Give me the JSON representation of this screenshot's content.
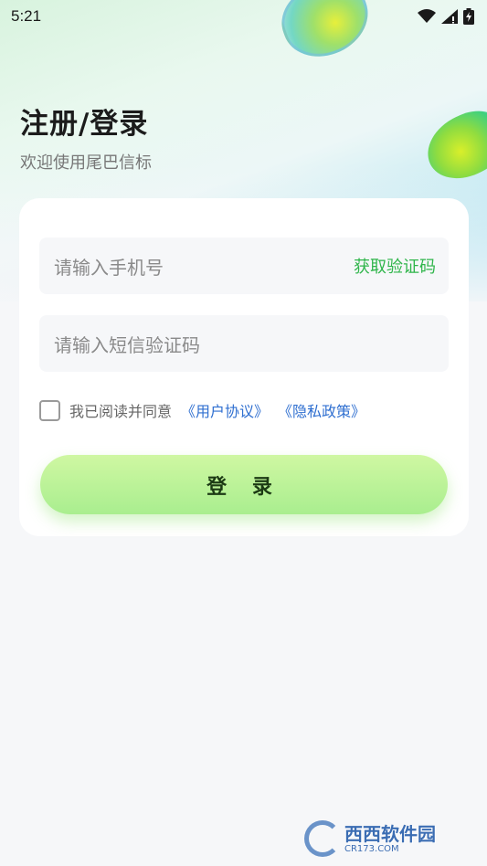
{
  "status_bar": {
    "time": "5:21"
  },
  "header": {
    "title": "注册/登录",
    "subtitle": "欢迎使用尾巴信标"
  },
  "form": {
    "phone_placeholder": "请输入手机号",
    "get_code_label": "获取验证码",
    "code_placeholder": "请输入短信验证码",
    "agree_text": "我已阅读并同意",
    "user_agreement_link": "《用户协议》",
    "privacy_policy_link": "《隐私政策》",
    "agree_checked": false,
    "login_label": "登 录"
  },
  "watermark": {
    "text": "西西软件园",
    "domain": "CR173.COM"
  },
  "colors": {
    "accent_green": "#2fb54a",
    "link_blue": "#2f6fd0",
    "button_green": "#b8f196"
  }
}
